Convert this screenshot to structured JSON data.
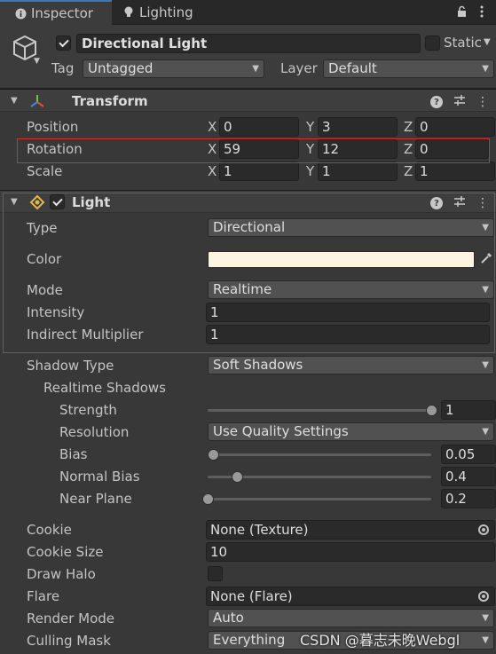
{
  "tabs": {
    "inspector": "Inspector",
    "lighting": "Lighting"
  },
  "object": {
    "name": "Directional Light",
    "active": true,
    "static_label": "Static",
    "static": false
  },
  "tag": {
    "label": "Tag",
    "value": "Untagged"
  },
  "layer": {
    "label": "Layer",
    "value": "Default"
  },
  "transform": {
    "title": "Transform",
    "position": {
      "label": "Position",
      "x": "0",
      "y": "3",
      "z": "0"
    },
    "rotation": {
      "label": "Rotation",
      "x": "59",
      "y": "12",
      "z": "0"
    },
    "scale": {
      "label": "Scale",
      "x": "1",
      "y": "1",
      "z": "1"
    },
    "axes": {
      "x": "X",
      "y": "Y",
      "z": "Z"
    }
  },
  "light": {
    "title": "Light",
    "enabled": true,
    "type": {
      "label": "Type",
      "value": "Directional"
    },
    "color": {
      "label": "Color",
      "value": "#fff4e1"
    },
    "mode": {
      "label": "Mode",
      "value": "Realtime"
    },
    "intensity": {
      "label": "Intensity",
      "value": "1"
    },
    "indirect": {
      "label": "Indirect Multiplier",
      "value": "1"
    },
    "shadow_type": {
      "label": "Shadow Type",
      "value": "Soft Shadows"
    },
    "realtime_shadows": "Realtime Shadows",
    "strength": {
      "label": "Strength",
      "value": "1",
      "fraction": 1.0
    },
    "resolution": {
      "label": "Resolution",
      "value": "Use Quality Settings"
    },
    "bias": {
      "label": "Bias",
      "value": "0.05",
      "fraction": 0.025
    },
    "normal_bias": {
      "label": "Normal Bias",
      "value": "0.4",
      "fraction": 0.13
    },
    "near_plane": {
      "label": "Near Plane",
      "value": "0.2",
      "fraction": 0.0
    },
    "cookie": {
      "label": "Cookie",
      "value": "None (Texture)"
    },
    "cookie_size": {
      "label": "Cookie Size",
      "value": "10"
    },
    "draw_halo": {
      "label": "Draw Halo",
      "value": false
    },
    "flare": {
      "label": "Flare",
      "value": "None (Flare)"
    },
    "render_mode": {
      "label": "Render Mode",
      "value": "Auto"
    },
    "culling_mask": {
      "label": "Culling Mask",
      "value": "Everything"
    }
  },
  "watermark": "CSDN @暮志未晚Webgl",
  "colors": {
    "accent": "#3a79bb",
    "highlight": "#d52f2f",
    "background": "#383838"
  }
}
